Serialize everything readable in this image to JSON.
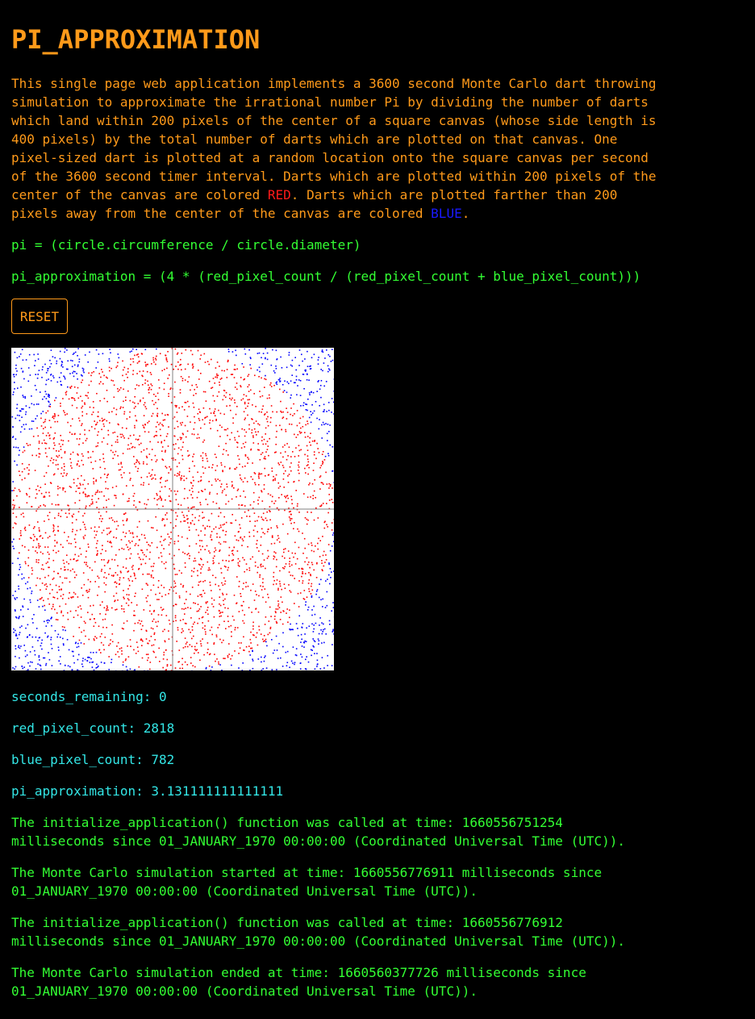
{
  "title": "PI_APPROXIMATION",
  "description": {
    "part1": "This single page web application implements a 3600 second Monte Carlo dart throwing simulation to approximate the irrational number Pi by dividing the number of darts which land within 200 pixels of the center of a square canvas (whose side length is 400 pixels) by the total number of darts which are plotted on that canvas. One pixel-sized dart is plotted at a random location onto the square canvas per second of the 3600 second timer interval. Darts which are plotted within 200 pixels of the center of the canvas are colored ",
    "red_word": "RED",
    "part2": ". Darts which are plotted farther than 200 pixels away from the center of the canvas are colored ",
    "blue_word": "BLUE",
    "part3": "."
  },
  "formulas": {
    "pi": "pi = (circle.circumference / circle.diameter)",
    "approximation": "pi_approximation = (4 * (red_pixel_count / (red_pixel_count + blue_pixel_count)))"
  },
  "reset_label": "RESET",
  "canvas": {
    "background": "#ffffff",
    "red_color": "#ff0000",
    "blue_color": "#0000ff",
    "axis_color": "#808080",
    "red_count": 2818,
    "blue_count": 782
  },
  "stats": {
    "seconds_remaining": "seconds_remaining: 0",
    "red_pixel_count": "red_pixel_count: 2818",
    "blue_pixel_count": "blue_pixel_count: 782",
    "pi_approximation": "pi_approximation: 3.131111111111111"
  },
  "log": [
    "The initialize_application() function was called at time: 1660556751254 milliseconds since 01_JANUARY_1970 00:00:00 (Coordinated Universal Time (UTC)).",
    "The Monte Carlo simulation started at time: 1660556776911 milliseconds since 01_JANUARY_1970 00:00:00 (Coordinated Universal Time (UTC)).",
    "The initialize_application() function was called at time: 1660556776912 milliseconds since 01_JANUARY_1970 00:00:00 (Coordinated Universal Time (UTC)).",
    "The Monte Carlo simulation ended at time: 1660560377726 milliseconds since 01_JANUARY_1970 00:00:00 (Coordinated Universal Time (UTC))."
  ]
}
